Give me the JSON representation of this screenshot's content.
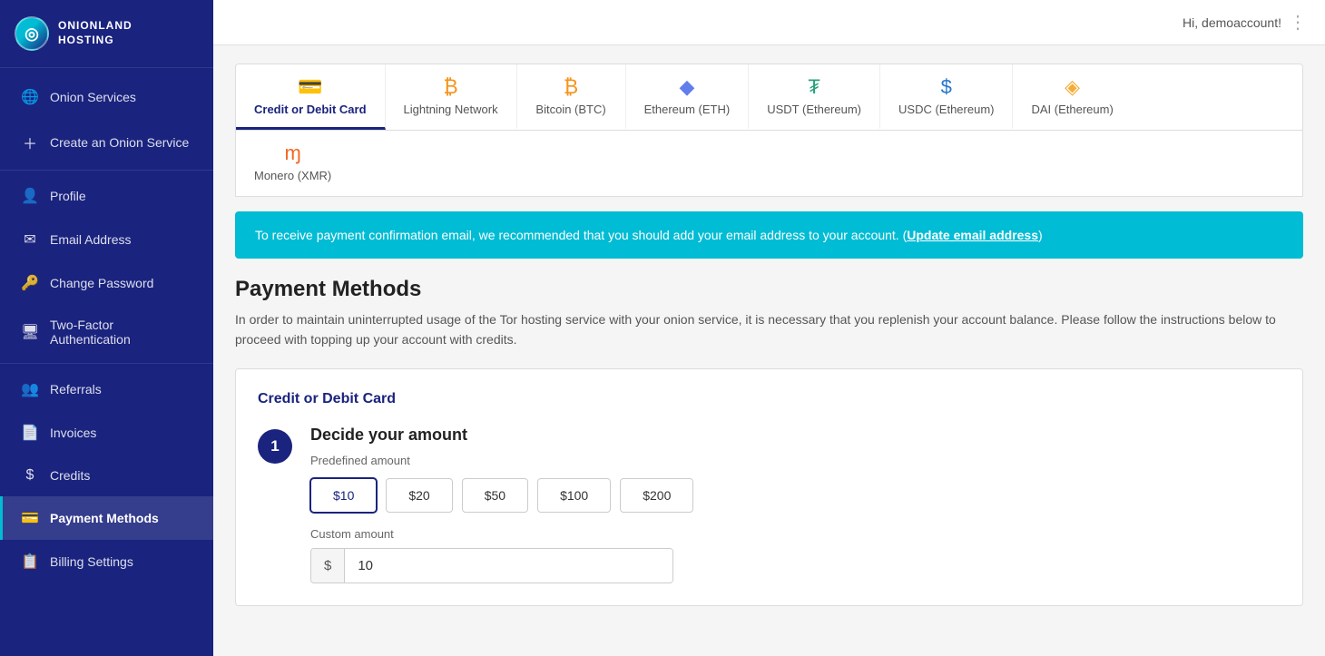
{
  "sidebar": {
    "logo": {
      "symbol": "◎",
      "line1": "ONIONLAND",
      "line2": "HOSTING"
    },
    "items": [
      {
        "id": "onion-services",
        "label": "Onion Services",
        "icon": "🌐",
        "active": false
      },
      {
        "id": "create-onion",
        "label": "Create an Onion Service",
        "icon": "+",
        "active": false
      },
      {
        "id": "profile",
        "label": "Profile",
        "icon": "👤",
        "active": false
      },
      {
        "id": "email-address",
        "label": "Email Address",
        "icon": "✉",
        "active": false
      },
      {
        "id": "change-password",
        "label": "Change Password",
        "icon": "🔑",
        "active": false
      },
      {
        "id": "two-factor",
        "label": "Two-Factor Authentication",
        "icon": "🖥",
        "active": false
      },
      {
        "id": "referrals",
        "label": "Referrals",
        "icon": "👥",
        "active": false
      },
      {
        "id": "invoices",
        "label": "Invoices",
        "icon": "📄",
        "active": false
      },
      {
        "id": "credits",
        "label": "Credits",
        "icon": "$",
        "active": false
      },
      {
        "id": "payment-methods",
        "label": "Payment Methods",
        "icon": "💳",
        "active": true
      },
      {
        "id": "billing-settings",
        "label": "Billing Settings",
        "icon": "📋",
        "active": false
      }
    ]
  },
  "topbar": {
    "greeting": "Hi, demoaccount!",
    "menu_icon": "⋮"
  },
  "payment_tabs": {
    "row1": [
      {
        "id": "credit-debit",
        "label": "Credit or Debit Card",
        "icon_type": "card",
        "active": true
      },
      {
        "id": "lightning",
        "label": "Lightning Network",
        "icon_type": "btc",
        "active": false
      },
      {
        "id": "bitcoin",
        "label": "Bitcoin (BTC)",
        "icon_type": "btc",
        "active": false
      },
      {
        "id": "ethereum",
        "label": "Ethereum (ETH)",
        "icon_type": "eth",
        "active": false
      },
      {
        "id": "usdt",
        "label": "USDT (Ethereum)",
        "icon_type": "usdt",
        "active": false
      },
      {
        "id": "usdc",
        "label": "USDC (Ethereum)",
        "icon_type": "usdc",
        "active": false
      },
      {
        "id": "dai",
        "label": "DAI (Ethereum)",
        "icon_type": "dai",
        "active": false
      }
    ],
    "row2": [
      {
        "id": "monero",
        "label": "Monero (XMR)",
        "icon_type": "xmr",
        "active": false
      }
    ]
  },
  "alert": {
    "text": "To receive payment confirmation email, we recommended that you should add your email address to your account. (",
    "link_text": "Update email address",
    "text_end": ")"
  },
  "payment_section": {
    "title": "Payment Methods",
    "description": "In order to maintain uninterrupted usage of the Tor hosting service with your onion service, it is necessary that you replenish your account balance. Please follow the instructions below to proceed with topping up your account with credits.",
    "card_title": "Credit or Debit Card",
    "step1": {
      "number": "1",
      "title": "Decide your amount",
      "predefined_label": "Predefined amount",
      "amounts": [
        "$10",
        "$20",
        "$50",
        "$100",
        "$200"
      ],
      "selected_amount": "$10",
      "custom_label": "Custom amount",
      "custom_prefix": "$",
      "custom_value": "10"
    }
  }
}
